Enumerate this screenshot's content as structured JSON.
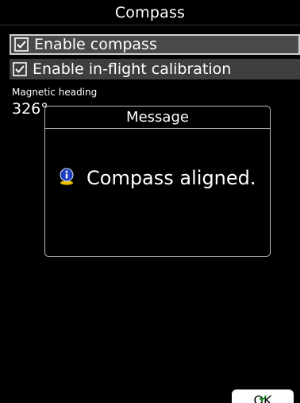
{
  "window": {
    "title": "Compass"
  },
  "settings": [
    {
      "label": "Enable compass",
      "checked": true,
      "selected": true
    },
    {
      "label": "Enable in-flight calibration",
      "checked": true,
      "selected": false
    }
  ],
  "magnetic": {
    "label": "Magnetic heading",
    "value": "326°"
  },
  "dialog": {
    "title": "Message",
    "message": "Compass aligned.",
    "icon": "info-icon"
  },
  "footer": {
    "ok_label": "OK",
    "ok_icon": "check-icon"
  },
  "colors": {
    "background": "#000000",
    "selected_row": "#4a4a4a",
    "row": "#3e3e3e",
    "info_blue": "#1f3fbf",
    "info_yellow": "#e8c000"
  }
}
